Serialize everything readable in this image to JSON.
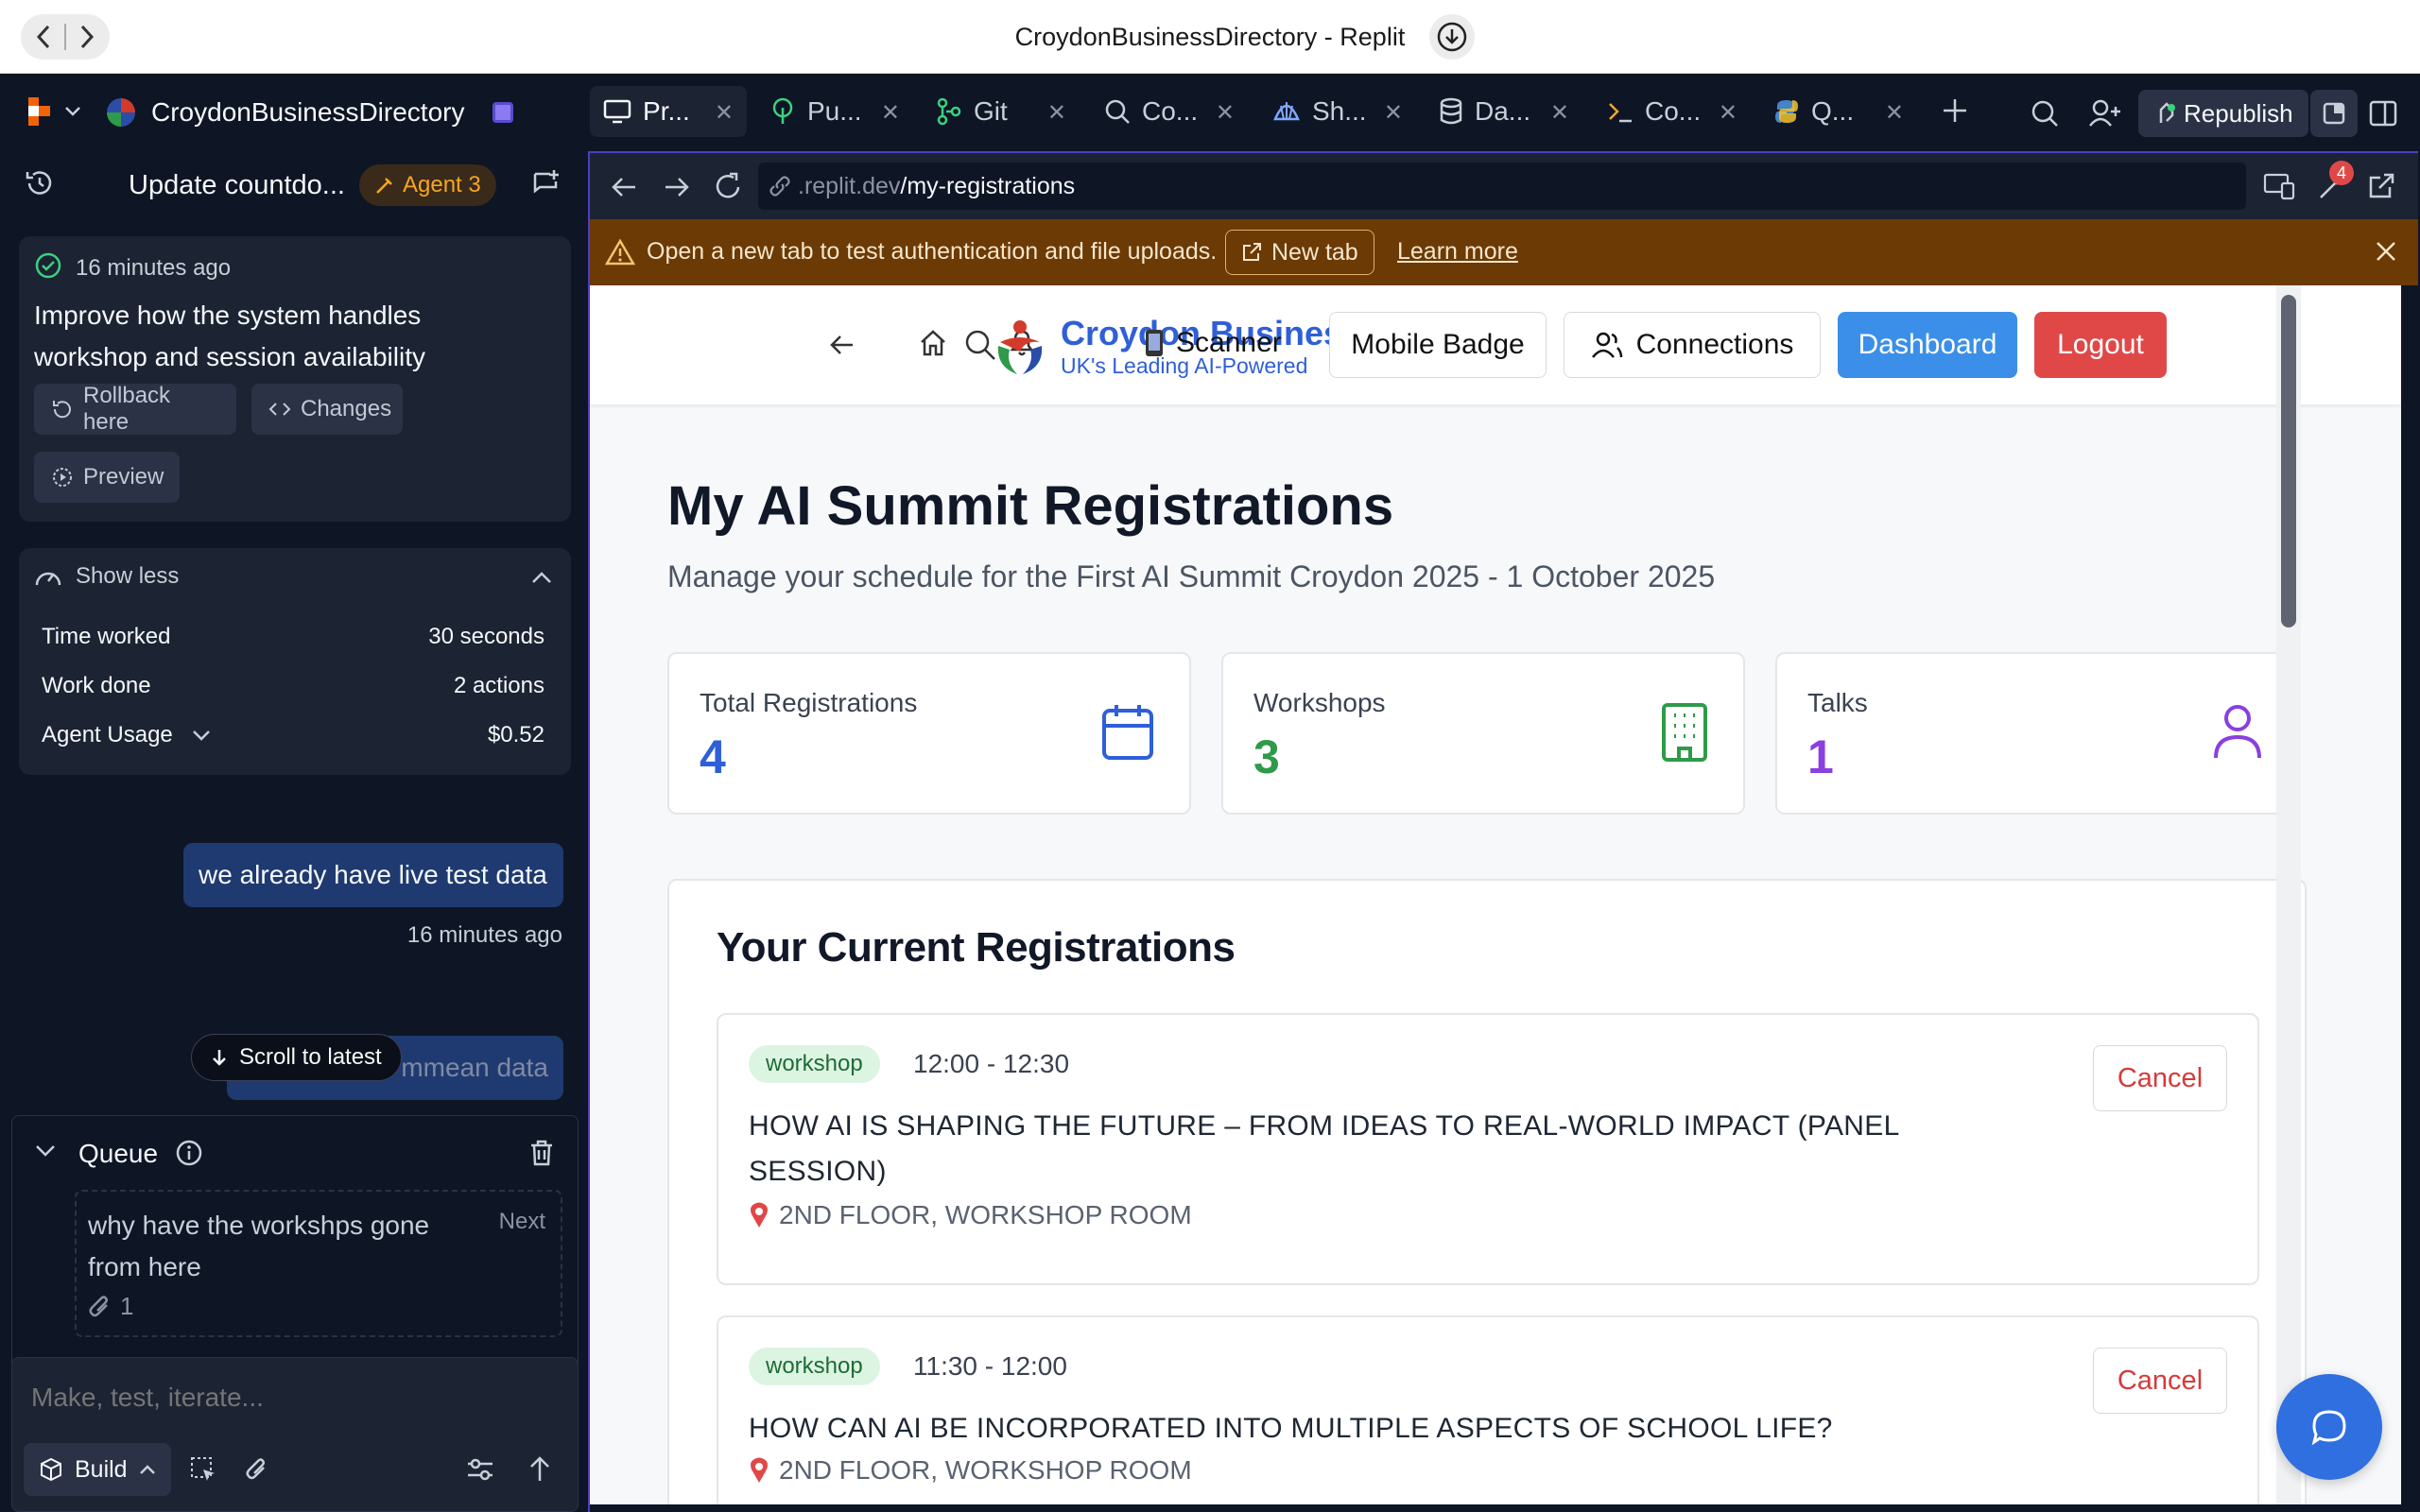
{
  "window": {
    "title": "CroydonBusinessDirectory - Replit"
  },
  "topbar": {
    "project_name": "CroydonBusinessDirectory",
    "tabs": [
      {
        "label": "Pr...",
        "icon": "monitor-icon"
      },
      {
        "label": "Pu...",
        "icon": "tree-icon"
      },
      {
        "label": "Git",
        "icon": "git-icon"
      },
      {
        "label": "Co...",
        "icon": "search-icon"
      },
      {
        "label": "Sh...",
        "icon": "shell-icon"
      },
      {
        "label": "Da...",
        "icon": "database-icon"
      },
      {
        "label": "Co...",
        "icon": "terminal-icon"
      },
      {
        "label": "Q...",
        "icon": "python-icon"
      }
    ],
    "republish_label": "Republish"
  },
  "agent": {
    "thread_title": "Update countdo...",
    "agent_badge": "Agent 3",
    "checkpoint": {
      "time": "16 minutes ago",
      "message": [
        "Improve how the system handles",
        "workshop and session availability"
      ],
      "rollback_label": "Rollback here",
      "changes_label": "Changes",
      "preview_label": "Preview"
    },
    "stats": {
      "toggle_label": "Show less",
      "rows": [
        {
          "label": "Time worked",
          "value": "30 seconds"
        },
        {
          "label": "Work done",
          "value": "2 actions"
        },
        {
          "label": "Agent Usage",
          "value": "$0.52"
        }
      ]
    },
    "user_message": {
      "text": "we already have live test data",
      "time": "16 minutes ago"
    },
    "partial_message": "mmean data",
    "scroll_latest_label": "Scroll to latest",
    "queue": {
      "title": "Queue",
      "item_text": [
        "why have the workshps gone",
        "from here"
      ],
      "item_next": "Next",
      "attachment_count": "1"
    },
    "input_placeholder": "Make, test, iterate...",
    "build_label": "Build"
  },
  "preview": {
    "url_muted": ".replit.dev",
    "url_path": "/my-registrations",
    "notification_count": "4",
    "banner": {
      "text": "Open a new tab to test authentication and file uploads.",
      "new_tab_label": "New tab",
      "learn_more_label": "Learn more"
    },
    "app": {
      "brand_name": "Croydon Busines",
      "brand_tagline": "UK's Leading AI-Powered",
      "scanner_label": "Scanner",
      "mobile_badge_label": "Mobile Badge",
      "connections_label": "Connections",
      "dashboard_label": "Dashboard",
      "logout_label": "Logout",
      "page_title": "My AI Summit Registrations",
      "page_subtitle": "Manage your schedule for the First AI Summit Croydon 2025 - 1 October 2025",
      "stats": [
        {
          "label": "Total Registrations",
          "value": "4",
          "color": "#2f5fd8",
          "icon": "calendar-icon"
        },
        {
          "label": "Workshops",
          "value": "3",
          "color": "#2f9a4a",
          "icon": "building-icon"
        },
        {
          "label": "Talks",
          "value": "1",
          "color": "#8a3fe0",
          "icon": "user-icon"
        }
      ],
      "section_title": "Your Current Registrations",
      "registrations": [
        {
          "type": "workshop",
          "time": "12:00 - 12:30",
          "title_lines": [
            "HOW AI IS SHAPING THE FUTURE – FROM IDEAS TO REAL-WORLD IMPACT (PANEL",
            "SESSION)"
          ],
          "location": "2ND FLOOR, WORKSHOP ROOM",
          "cancel_label": "Cancel"
        },
        {
          "type": "workshop",
          "time": "11:30 - 12:00",
          "title_lines": [
            "HOW CAN AI BE INCORPORATED INTO MULTIPLE ASPECTS OF SCHOOL LIFE?"
          ],
          "location": "2ND FLOOR, WORKSHOP ROOM",
          "cancel_label": "Cancel"
        }
      ]
    }
  },
  "colors": {
    "accent": "#4e3ec0",
    "primary": "#3b8fe8",
    "danger": "#e04848",
    "banner": "#6b3a05"
  }
}
